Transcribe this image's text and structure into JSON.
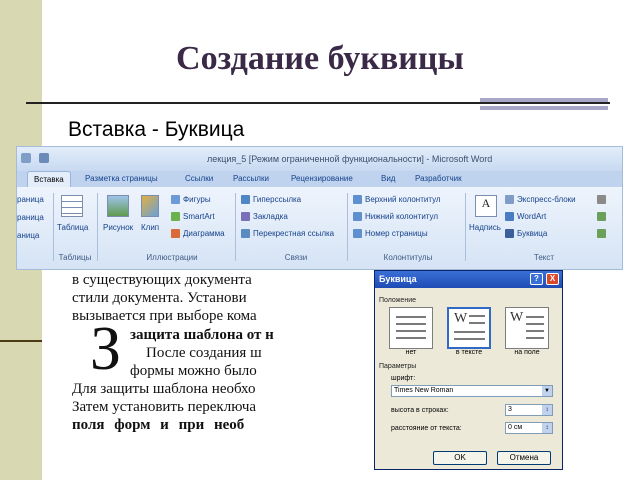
{
  "slide": {
    "title": "Создание буквицы",
    "subtitle": "Вставка - Буквица"
  },
  "ribbon": {
    "window_title": "лекция_5 [Режим ограниченной функциональности] - Microsoft Word",
    "tabs": [
      "Вставка",
      "Разметка страницы",
      "Ссылки",
      "Рассылки",
      "Рецензирование",
      "Вид",
      "Разработчик"
    ],
    "active_tab": "Вставка",
    "cut_left": [
      "раница",
      "раница",
      "аница"
    ],
    "tables": {
      "label": "Таблица",
      "group": "Таблицы"
    },
    "illustrations": {
      "picture": "Рисунок",
      "clip": "Клип",
      "shapes": "Фигуры",
      "smartart": "SmartArt",
      "chart": "Диаграмма",
      "group": "Иллюстрации"
    },
    "links": {
      "hyperlink": "Гиперссылка",
      "bookmark": "Закладка",
      "crossref": "Перекрестная ссылка",
      "group": "Связи"
    },
    "headers": {
      "header": "Верхний колонтитул",
      "footer": "Нижний колонтитул",
      "page_number": "Номер страницы",
      "group": "Колонтитулы"
    },
    "text": {
      "textbox": "Надпись",
      "quickparts": "Экспресс-блоки",
      "wordart": "WordArt",
      "dropcap": "Буквица",
      "group": "Текст"
    }
  },
  "document": {
    "lines": [
      "в существующих документа",
      "стили документа. Установи",
      "вызывается при выборе кома",
      "защита шаблона от н",
      "После создания ш",
      "формы можно было",
      "Для защиты шаблона необхо",
      "Затем установить переключа",
      "поля форм и при необ"
    ],
    "drop_letter": "З"
  },
  "dialog": {
    "title": "Буквица",
    "position_label": "Положение",
    "options": [
      "нет",
      "в тексте",
      "на поле"
    ],
    "selected_option": "в тексте",
    "params_label": "Параметры",
    "font_label": "шрифт:",
    "font_value": "Times New Roman",
    "lines_label": "высота в строках:",
    "lines_value": "3",
    "distance_label": "расстояние от текста:",
    "distance_value": "0 см",
    "ok": "OK",
    "cancel": "Отмена",
    "help": "?",
    "close": "X",
    "glyph": "W"
  }
}
